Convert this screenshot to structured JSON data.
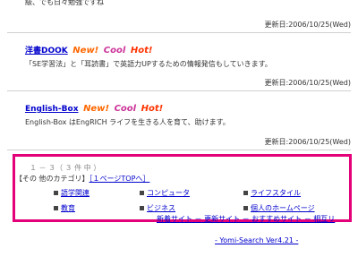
{
  "top_text": "級、でも日々勉強ですね",
  "entries": [
    {
      "date": "更新日:2006/10/25(Wed)",
      "title": "洋書DOOK",
      "description": "「SE学習法」と「耳読書」で英語力UPするための情報発信もしていきます。",
      "date2": "更新日:2006/10/25(Wed)"
    },
    {
      "title": "English-Box",
      "description": "English-Box はEngRICH ライフを生きる人を育て、助けます。",
      "date": "更新日:2006/10/25(Wed)"
    }
  ],
  "badges": {
    "new": "New!",
    "cool": "Cool",
    "hot": "Hot!"
  },
  "result_count": "１ － ３（ ３ 件 中 ）",
  "other_categories_label": "【その 他のカテゴリ】",
  "page_top_link": "［１ページTOPへ］",
  "categories": [
    "語学関連",
    "コンピュータ",
    "ライフスタイル",
    "教育",
    "ビジネス",
    "個人のホームページ"
  ],
  "footer_links": "新着サイト － 更新サイト － おすすめサイト － 相互リ",
  "powered_by": "- Yomi-Search Ver4.21 -"
}
